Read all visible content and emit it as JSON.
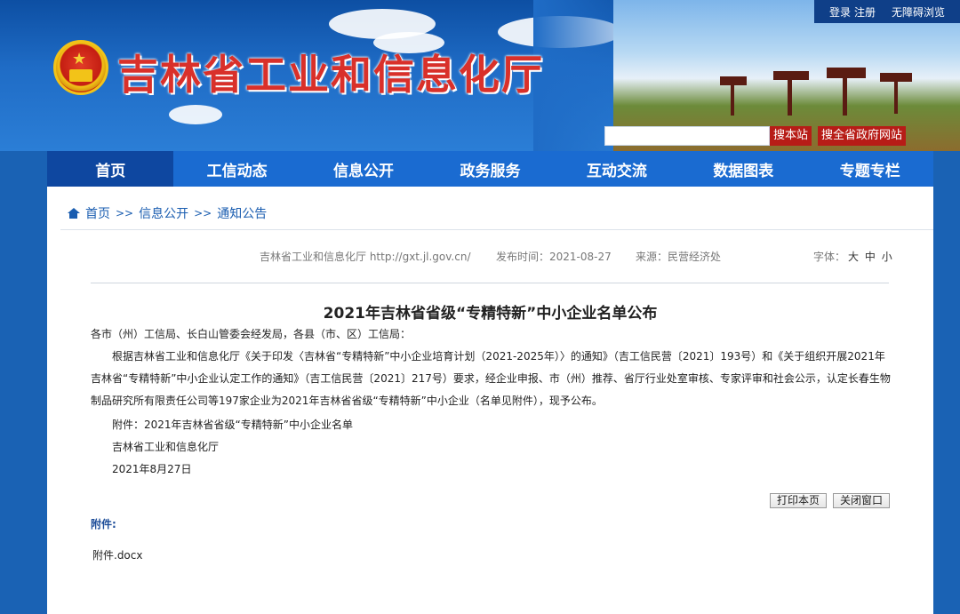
{
  "header": {
    "site_title": "吉林省工业和信息化厅",
    "top_links": {
      "login": "登录",
      "register": "注册",
      "accessible": "无障碍浏览"
    },
    "search": {
      "this_site": "搜本站",
      "all_gov": "搜全省政府网站"
    }
  },
  "nav": {
    "items": [
      "首页",
      "工信动态",
      "信息公开",
      "政务服务",
      "互动交流",
      "数据图表",
      "专题专栏"
    ]
  },
  "breadcrumb": {
    "home": "首页",
    "sep": ">>",
    "level1": "信息公开",
    "level2": "通知公告"
  },
  "meta": {
    "source_site": "吉林省工业和信息化厅 http://gxt.jl.gov.cn/",
    "publish_time": "发布时间：2021-08-27",
    "origin": "来源：民营经济处",
    "font_label": "字体：",
    "font_large": "大",
    "font_medium": "中",
    "font_small": "小"
  },
  "article": {
    "title": "2021年吉林省省级“专精特新”中小企业名单公布",
    "salutation": "各市（州）工信局、长白山管委会经发局，各县（市、区）工信局：",
    "body": "根据吉林省工业和信息化厅《关于印发〈吉林省“专精特新”中小企业培育计划（2021-2025年）〉的通知》（吉工信民营〔2021〕193号）和《关于组织开展2021年吉林省“专精特新”中小企业认定工作的通知》（吉工信民营〔2021〕217号）要求，经企业申报、市（州）推荐、省厅行业处室审核、专家评审和社会公示，认定长春生物制品研究所有限责任公司等197家企业为2021年吉林省省级“专精特新”中小企业（名单见附件），现予公布。",
    "attachment_note": "附件：2021年吉林省省级“专精特新”中小企业名单",
    "signer": "吉林省工业和信息化厅",
    "date": "2021年8月27日"
  },
  "actions": {
    "print": "打印本页",
    "close": "关闭窗口"
  },
  "attachments": {
    "label": "附件:",
    "file": "附件.docx"
  }
}
